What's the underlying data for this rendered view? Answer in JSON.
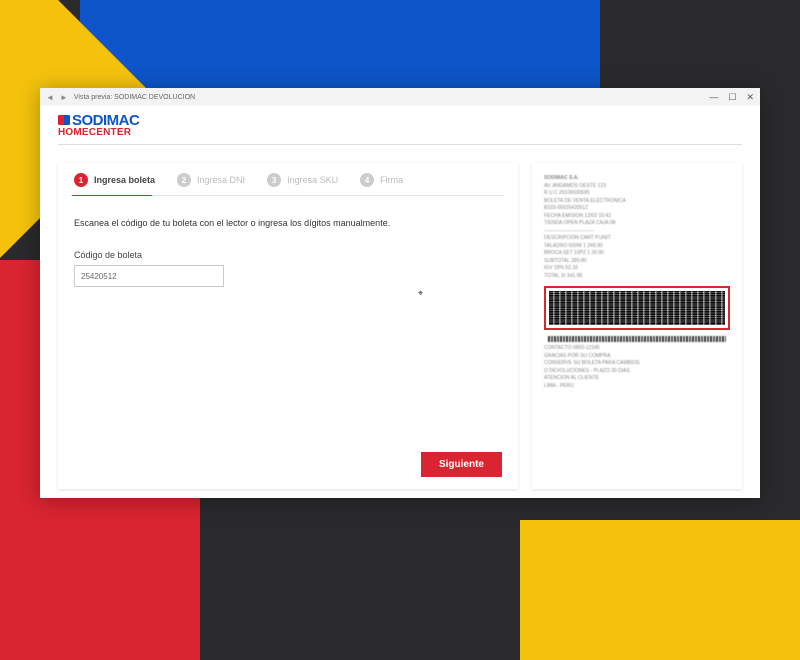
{
  "window": {
    "title": "Vista previa: SODIMAC DEVOLUCION"
  },
  "brand": {
    "line1": "SODIMAC",
    "line2": "HOMECENTER"
  },
  "stepper": {
    "steps": [
      {
        "num": "1",
        "label": "Ingresa boleta"
      },
      {
        "num": "2",
        "label": "Ingresa DNI"
      },
      {
        "num": "3",
        "label": "Ingresa SKU"
      },
      {
        "num": "4",
        "label": "Firma"
      }
    ]
  },
  "form": {
    "instruction": "Escanea el código de tu boleta con el lector o ingresa los dígitos  manualmente.",
    "field_label": "Código de boleta",
    "field_value": "25420512",
    "next_label": "Siguiente"
  },
  "receipt": {
    "header": "SODIMAC S.A.",
    "lines_top": [
      "AV. ANGAMOS OESTE 123",
      "R.U.C  20100030595",
      "  ",
      "BOLETA DE VENTA ELECTRONICA",
      "B103-00025420512",
      "FECHA EMISION  12/03  15:42",
      "TIENDA OPEN PLAZA    CAJA 08",
      "------------------------------",
      "DESCRIPCION        CANT   P.UNIT",
      "TALADRO 600W         1   249.90",
      "BROCA SET 10PZ       1    39.90",
      "SUBTOTAL                 289.80",
      "IGV 18%                   52.16",
      "TOTAL S/                 341.96"
    ],
    "lines_bottom": [
      "CONTACTO  0800-12345",
      "GRACIAS POR SU COMPRA",
      "  ",
      "CONSERVE SU BOLETA PARA CAMBIOS",
      "O DEVOLUCIONES  - PLAZO 30 DIAS",
      "ATENCION AL CLIENTE",
      "LIMA - PERU"
    ]
  }
}
